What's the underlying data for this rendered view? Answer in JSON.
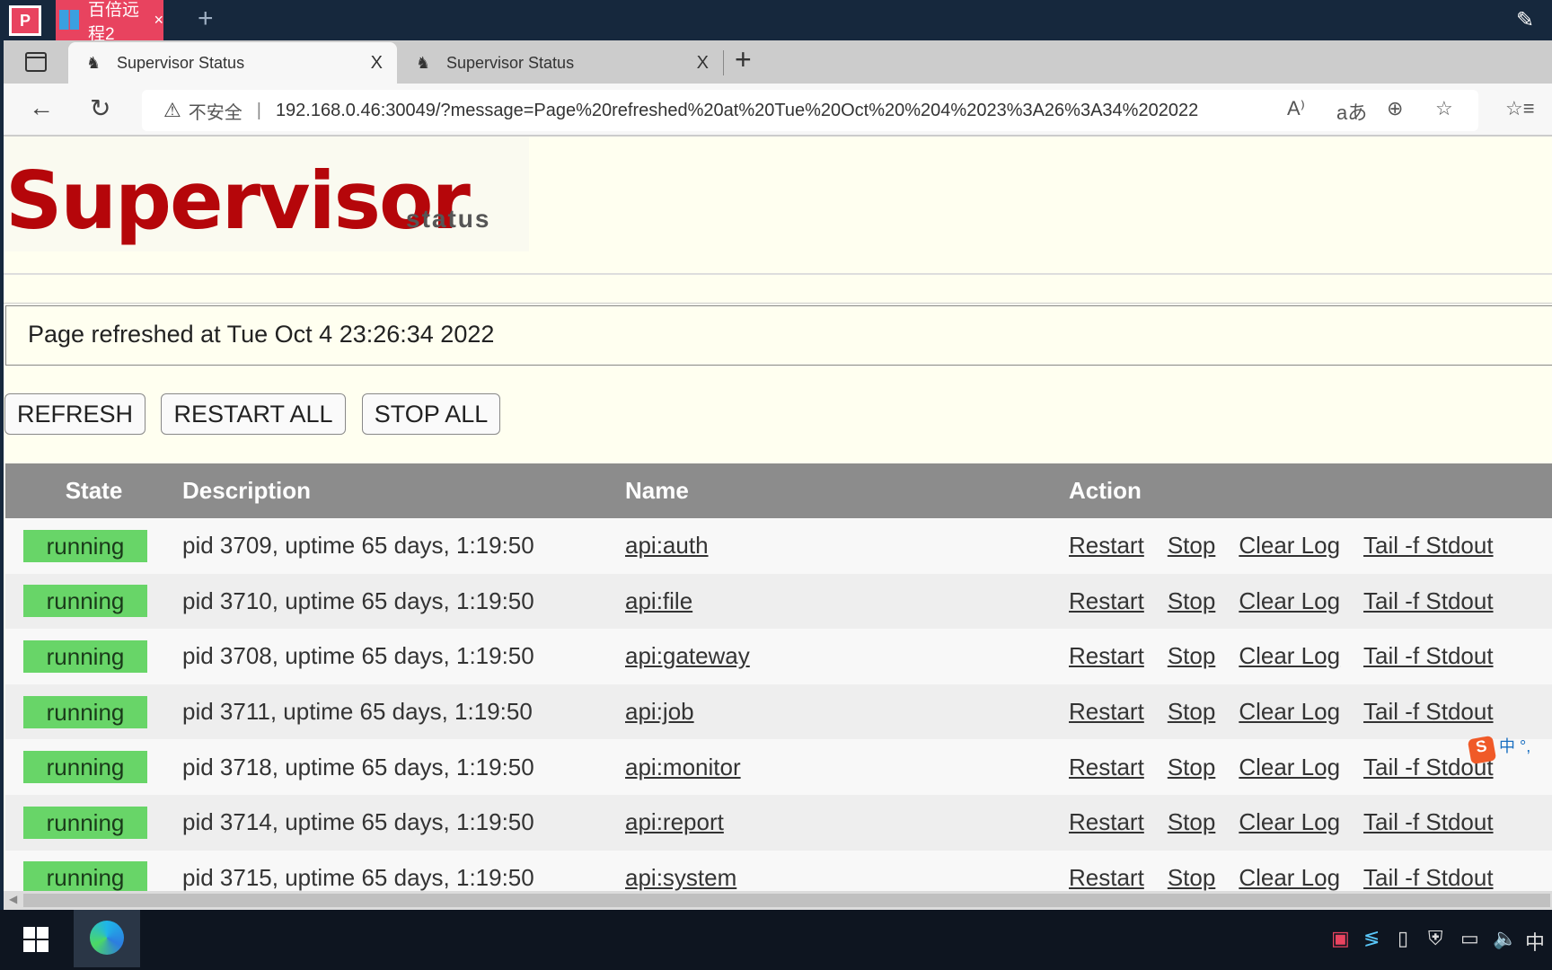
{
  "os": {
    "app_tab": "百倍远程2",
    "app_tab_close": "×",
    "add": "+",
    "app_logo": "P"
  },
  "browser": {
    "tabs": [
      {
        "title": "Supervisor Status",
        "active": true
      },
      {
        "title": "Supervisor Status",
        "active": false
      }
    ],
    "close": "X",
    "new_tab": "+",
    "security_label": "不安全",
    "url": "192.168.0.46:30049/?message=Page%20refreshed%20at%20Tue%20Oct%20%204%2023%3A26%3A34%202022"
  },
  "page": {
    "logo": "Supervisor",
    "logo_sub": "status",
    "message": "Page refreshed at Tue Oct 4 23:26:34 2022",
    "buttons": {
      "refresh": "REFRESH",
      "restart_all": "RESTART ALL",
      "stop_all": "STOP ALL"
    },
    "table": {
      "headers": {
        "state": "State",
        "description": "Description",
        "name": "Name",
        "action": "Action"
      },
      "actions": {
        "restart": "Restart",
        "stop": "Stop",
        "clear_log": "Clear Log",
        "tail": "Tail -f Stdout"
      },
      "rows": [
        {
          "state": "running",
          "description": "pid 3709, uptime 65 days, 1:19:50",
          "name": "api:auth"
        },
        {
          "state": "running",
          "description": "pid 3710, uptime 65 days, 1:19:50",
          "name": "api:file"
        },
        {
          "state": "running",
          "description": "pid 3708, uptime 65 days, 1:19:50",
          "name": "api:gateway"
        },
        {
          "state": "running",
          "description": "pid 3711, uptime 65 days, 1:19:50",
          "name": "api:job"
        },
        {
          "state": "running",
          "description": "pid 3718, uptime 65 days, 1:19:50",
          "name": "api:monitor"
        },
        {
          "state": "running",
          "description": "pid 3714, uptime 65 days, 1:19:50",
          "name": "api:report"
        },
        {
          "state": "running",
          "description": "pid 3715, uptime 65 days, 1:19:50",
          "name": "api:system"
        }
      ]
    }
  },
  "ime": {
    "label": "中"
  },
  "taskbar": {
    "ime": "中"
  },
  "colors": {
    "running": "#68d568",
    "logo": "#b5060a",
    "header": "#8c8c8c",
    "titlebar": "#16283d",
    "app_tab": "#e8435f"
  }
}
